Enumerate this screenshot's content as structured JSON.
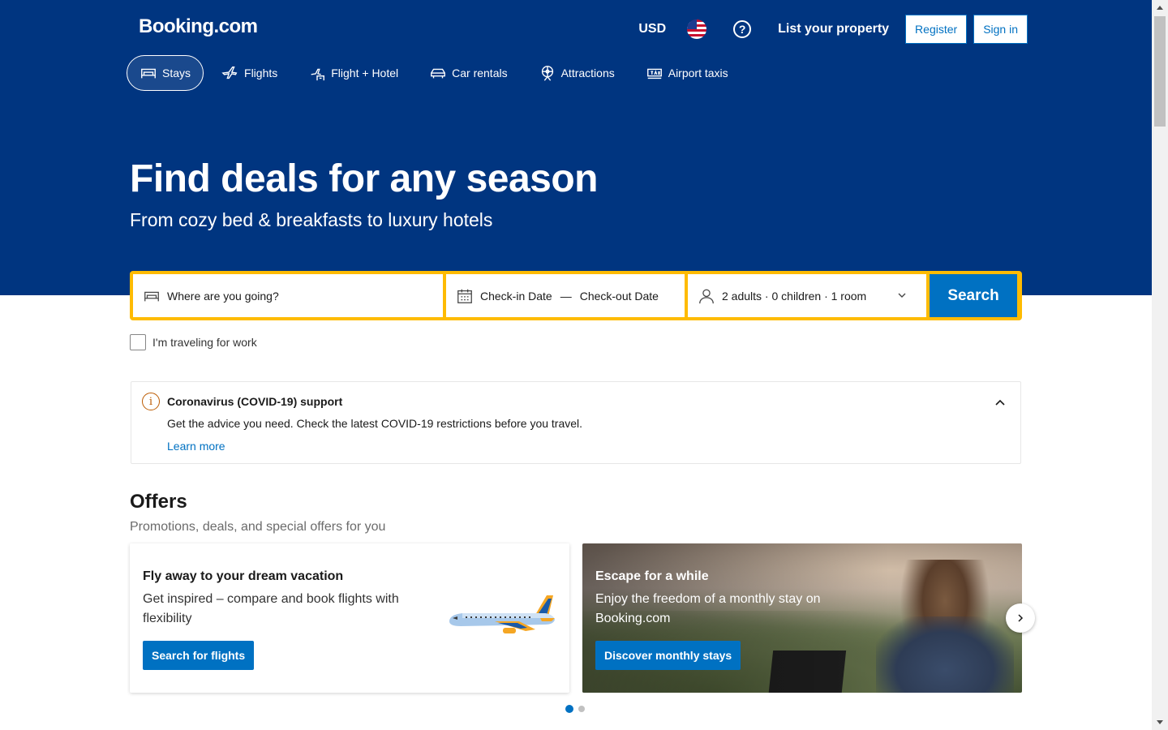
{
  "header": {
    "logo": "Booking.com",
    "currency": "USD",
    "flag_icon": "us-flag-icon",
    "help_icon": "?",
    "list_property": "List your property",
    "register": "Register",
    "sign_in": "Sign in"
  },
  "tabs": [
    {
      "label": "Stays",
      "icon": "bed-icon",
      "active": true
    },
    {
      "label": "Flights",
      "icon": "plane-icon"
    },
    {
      "label": "Flight + Hotel",
      "icon": "flight-hotel-icon"
    },
    {
      "label": "Car rentals",
      "icon": "car-icon"
    },
    {
      "label": "Attractions",
      "icon": "ferris-wheel-icon"
    },
    {
      "label": "Airport taxis",
      "icon": "taxi-icon"
    }
  ],
  "hero": {
    "title": "Find deals for any season",
    "subtitle": "From cozy bed & breakfasts to luxury hotels"
  },
  "search": {
    "destination_placeholder": "Where are you going?",
    "checkin": "Check-in Date",
    "dash": "—",
    "checkout": "Check-out Date",
    "guests": "2 adults · 0 children · 1 room",
    "button": "Search"
  },
  "work_checkbox": {
    "label": "I'm traveling for work",
    "checked": false
  },
  "covid": {
    "title": "Coronavirus (COVID-19) support",
    "text": "Get the advice you need. Check the latest COVID-19 restrictions before you travel.",
    "link": "Learn more"
  },
  "offers": {
    "title": "Offers",
    "subtitle": "Promotions, deals, and special offers for you",
    "cards": [
      {
        "title": "Fly away to your dream vacation",
        "text": "Get inspired – compare and book flights with flexibility",
        "button": "Search for flights"
      },
      {
        "title": "Escape for a while",
        "text": "Enjoy the freedom of a monthly stay on Booking.com",
        "button": "Discover monthly stays"
      }
    ],
    "carousel_pages": 2,
    "active_page": 1
  },
  "colors": {
    "brand_blue": "#003580",
    "action_blue": "#0071c2",
    "search_border": "#febb02"
  }
}
